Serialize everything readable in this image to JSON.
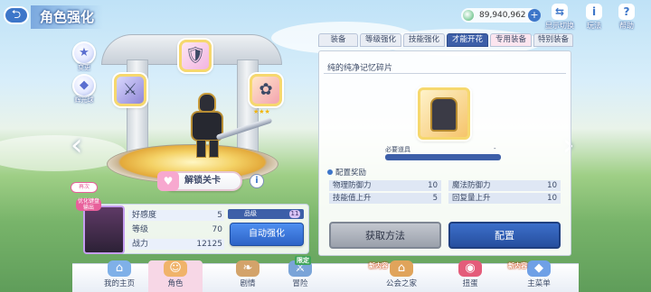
{
  "header": {
    "back_icon": "back-arrow-icon",
    "title": "角色强化",
    "currency": "89,940,962",
    "currency_plus": "+",
    "buttons": [
      {
        "label": "显示切换",
        "icon": "display-switch-icon"
      },
      {
        "label": "玩法",
        "icon": "info-icon"
      },
      {
        "label": "帮助",
        "icon": "help-icon"
      }
    ]
  },
  "left_side": {
    "change_label": "变更",
    "shine_label": "辉光球",
    "chip_text": "优化键盘输出",
    "portrait_badge": "再次"
  },
  "stage": {
    "unlock_label": "解锁关卡",
    "info_symbol": "i",
    "equip_stars": "★★★"
  },
  "status": {
    "rows": [
      {
        "label": "好感度",
        "value": "5"
      },
      {
        "label": "等级",
        "value": "70"
      },
      {
        "label": "战力",
        "value": "12125"
      }
    ],
    "rank_label": "品级",
    "rank_value": "11",
    "auto_button": "自动强化"
  },
  "tabs": [
    {
      "label": "装备",
      "active": false
    },
    {
      "label": "等级强化",
      "active": false
    },
    {
      "label": "技能强化",
      "active": false
    },
    {
      "label": "才能开花",
      "active": true
    },
    {
      "label": "专用装备",
      "active": false
    },
    {
      "label": "特别装备",
      "active": false
    }
  ],
  "panel": {
    "title": "纯的纯净记忆碎片",
    "need_label": "必要道具",
    "need_value": "-",
    "section_title": "配置奖励",
    "bonuses": [
      {
        "label": "物理防御力",
        "value": "10"
      },
      {
        "label": "魔法防御力",
        "value": "10"
      },
      {
        "label": "技能值上升",
        "value": "5"
      },
      {
        "label": "回复量上升",
        "value": "10"
      }
    ],
    "get_button": "获取方法",
    "equip_button": "配置"
  },
  "nav": [
    {
      "label": "我的主页",
      "icon": "home-icon",
      "tag": ""
    },
    {
      "label": "角色",
      "icon": "character-icon",
      "tag": ""
    },
    {
      "label": "剧情",
      "icon": "story-icon",
      "tag": ""
    },
    {
      "label": "冒险",
      "icon": "adventure-icon",
      "tag": "限定"
    },
    {
      "label": "公会之家",
      "icon": "guild-house-icon",
      "tag": "新内容"
    },
    {
      "label": "扭蛋",
      "icon": "gacha-icon",
      "tag": ""
    },
    {
      "label": "主菜单",
      "icon": "main-menu-icon",
      "tag": "新内容"
    }
  ],
  "colors": {
    "accent": "#3d5fa8",
    "active_tab": "#3d5fa8",
    "nav_active": "#f7d7e6"
  }
}
